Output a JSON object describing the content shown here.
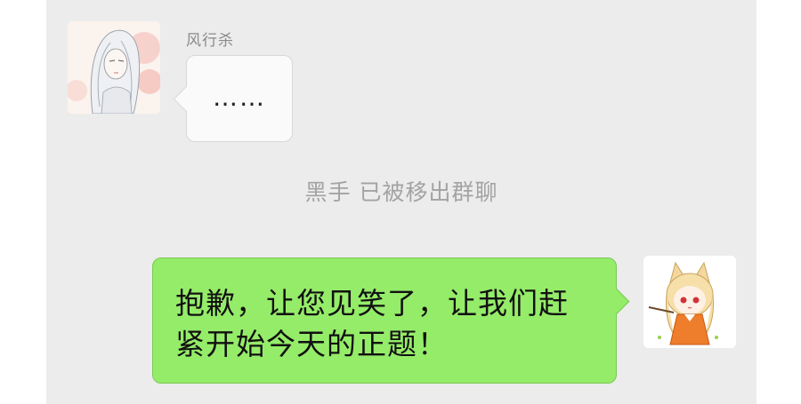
{
  "messages": {
    "incoming": {
      "sender_name": "风行杀",
      "text": "……",
      "avatar_icon": "long-haired-character-avatar-icon"
    },
    "system_notice": "黑手 已被移出群聊",
    "outgoing": {
      "text": "抱歉，让您见笑了，让我们赶紧开始今天的正题！",
      "avatar_icon": "chibi-fox-girl-avatar-icon"
    }
  },
  "colors": {
    "chat_background": "#ececec",
    "incoming_bubble": "#fafafa",
    "outgoing_bubble": "#95ec69",
    "system_text": "#a3a3a3"
  }
}
